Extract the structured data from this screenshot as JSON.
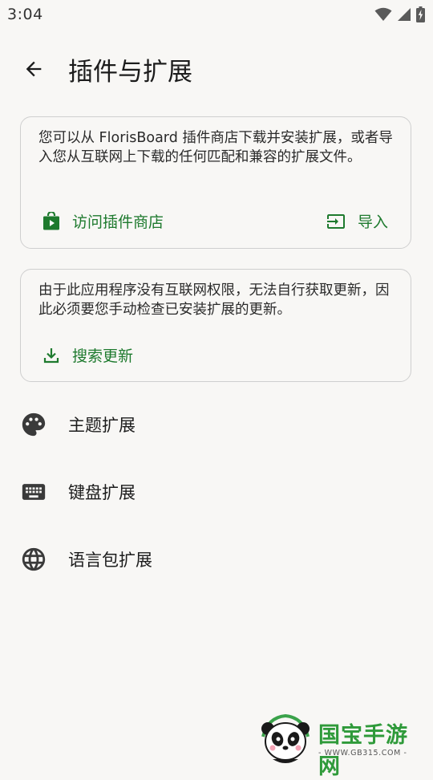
{
  "status_bar": {
    "time": "3:04"
  },
  "app_bar": {
    "title": "插件与扩展"
  },
  "store_card": {
    "text": "您可以从 FlorisBoard 插件商店下载并安装扩展，或者导入您从互联网上下载的任何匹配和兼容的扩展文件。",
    "visit_store_label": "访问插件商店",
    "import_label": "导入"
  },
  "update_card": {
    "text": "由于此应用程序没有互联网权限，无法自行获取更新，因此必须要您手动检查已安装扩展的更新。",
    "search_updates_label": "搜索更新"
  },
  "list": {
    "items": [
      {
        "label": "主题扩展",
        "icon": "palette-icon"
      },
      {
        "label": "键盘扩展",
        "icon": "keyboard-icon"
      },
      {
        "label": "语言包扩展",
        "icon": "globe-icon"
      }
    ]
  },
  "watermark": {
    "title": "国宝手游网",
    "url": "- WWW.GB315.COM -"
  },
  "colors": {
    "accent": "#1e7a2e",
    "background": "#f8f7f5",
    "border": "#cfcfcf"
  }
}
